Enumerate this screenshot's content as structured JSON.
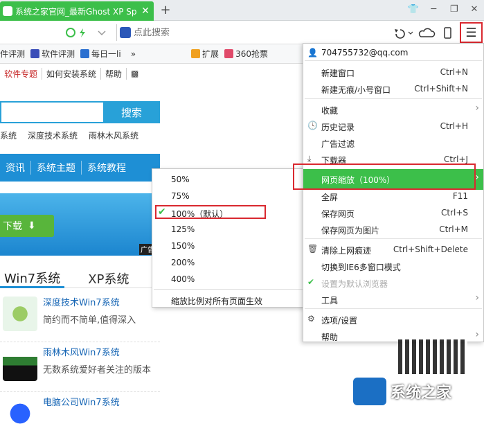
{
  "tabbar": {
    "tab_title": "系统之家官网_最新Ghost XP Sp",
    "tab_close": "✕",
    "new_tab": "+"
  },
  "addressbar": {
    "search_placeholder": "点此搜索"
  },
  "bookmarks": [
    {
      "label": "件评测"
    },
    {
      "label": "软件评测"
    },
    {
      "label": "每日一li"
    },
    {
      "label": "»"
    },
    {
      "label": "扩展"
    },
    {
      "label": "360抢票"
    }
  ],
  "page": {
    "topnav": [
      "软件专题",
      "如何安装系统",
      "帮助"
    ],
    "search_button": "搜索",
    "sitelinks": [
      "系统",
      "深度技术系统",
      "雨林木风系统"
    ],
    "bluenav": [
      "资讯",
      "系统主题",
      "系统教程"
    ],
    "download_button": "下载",
    "ad_tag": "广告",
    "ostabs": [
      "Win7系统",
      "XP系统"
    ],
    "list": [
      {
        "title": "深度技术Win7系统",
        "desc": "简约而不简单,值得深入"
      },
      {
        "title": "雨林木风Win7系统",
        "desc": "无数系统爱好者关注的版本"
      },
      {
        "title": "电脑公司Win7系统",
        "desc": ""
      }
    ]
  },
  "zoom_menu": {
    "items": [
      "50%",
      "75%",
      "100%（默认）",
      "125%",
      "150%",
      "200%",
      "400%"
    ],
    "selected": "100%（默认）",
    "apply_all": "缩放比例对所有页面生效"
  },
  "main_menu": {
    "account": "704755732@qq.com",
    "items": [
      {
        "label": "新建窗口",
        "shortcut": "Ctrl+N"
      },
      {
        "label": "新建无痕/小号窗口",
        "shortcut": "Ctrl+Shift+N"
      },
      {
        "label": "收藏",
        "shortcut": ""
      },
      {
        "label": "历史记录",
        "shortcut": "Ctrl+H"
      },
      {
        "label": "广告过滤",
        "shortcut": ""
      },
      {
        "label": "下载器",
        "shortcut": "Ctrl+J"
      },
      {
        "label": "网页缩放（100%）",
        "shortcut": ""
      },
      {
        "label": "全屏",
        "shortcut": "F11"
      },
      {
        "label": "保存网页",
        "shortcut": "Ctrl+S"
      },
      {
        "label": "保存网页为图片",
        "shortcut": "Ctrl+M"
      },
      {
        "label": "清除上网痕迹",
        "shortcut": "Ctrl+Shift+Delete"
      },
      {
        "label": "切换到IE6多窗口模式",
        "shortcut": ""
      },
      {
        "label": "设置为默认浏览器",
        "shortcut": ""
      },
      {
        "label": "工具",
        "shortcut": ""
      },
      {
        "label": "选项/设置",
        "shortcut": ""
      },
      {
        "label": "帮助",
        "shortcut": ""
      }
    ]
  },
  "watermark": {
    "text": "系统之家"
  },
  "colors": {
    "accent_green": "#3cbf4a",
    "highlight_red": "#d9282f",
    "page_blue": "#1e8fd5"
  }
}
